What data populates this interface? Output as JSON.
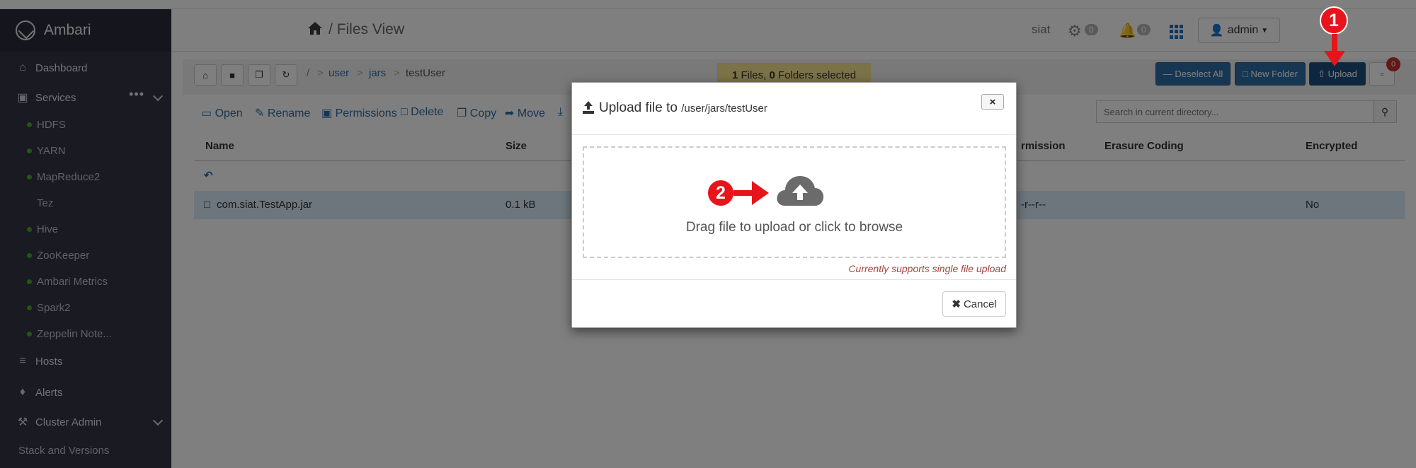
{
  "brand": {
    "name": "Ambari"
  },
  "sidebar": {
    "items": [
      {
        "label": "Dashboard",
        "icon": "home-icon"
      },
      {
        "label": "Services",
        "icon": "briefcase-icon"
      },
      {
        "label": "Hosts",
        "icon": "server-icon"
      },
      {
        "label": "Alerts",
        "icon": "bell-icon"
      },
      {
        "label": "Cluster Admin",
        "icon": "wrench-icon"
      }
    ],
    "services": [
      "HDFS",
      "YARN",
      "MapReduce2",
      "Tez",
      "Hive",
      "ZooKeeper",
      "Ambari Metrics",
      "Spark2",
      "Zeppelin Note..."
    ],
    "stack_versions": "Stack and Versions"
  },
  "header": {
    "title": "Files View",
    "separator": "/",
    "cluster": "siat",
    "ops_count": "0",
    "alerts_count": "0",
    "admin_label": "admin"
  },
  "toolbar": {
    "breadcrumb": [
      "/",
      ">",
      "user",
      ">",
      "jars",
      ">",
      "testUser"
    ],
    "files_count": "1",
    "files_label": "Files,",
    "folders_count": "0",
    "folders_label": "Folders selected",
    "deselect_all": "Deselect All",
    "new_folder": "New Folder",
    "upload": "Upload",
    "messages_count": "0",
    "search_placeholder": "Search in current directory..."
  },
  "operations": [
    "Open",
    "Rename",
    "Permissions",
    "Delete",
    "Copy",
    "Move"
  ],
  "table": {
    "columns": [
      "Name",
      "Size",
      "Permission",
      "Erasure Coding",
      "Encrypted"
    ],
    "permission_header_visible": "rmission",
    "rows": [
      {
        "name": "com.siat.TestApp.jar",
        "size": "0.1 kB",
        "permission_visible": "-r--r--",
        "encrypted": "No"
      }
    ]
  },
  "modal": {
    "title": "Upload file to",
    "path": "/user/jars/testUser",
    "close": "×",
    "drop_text": "Drag file to upload or click to browse",
    "note": "Currently supports single file upload",
    "cancel": "Cancel"
  },
  "annotations": {
    "step1": "1",
    "step2": "2"
  },
  "colors": {
    "sidebar": "#323544",
    "accent": "#2e6da4",
    "annotation": "#e8141b",
    "highlight": "#f7e58e"
  }
}
